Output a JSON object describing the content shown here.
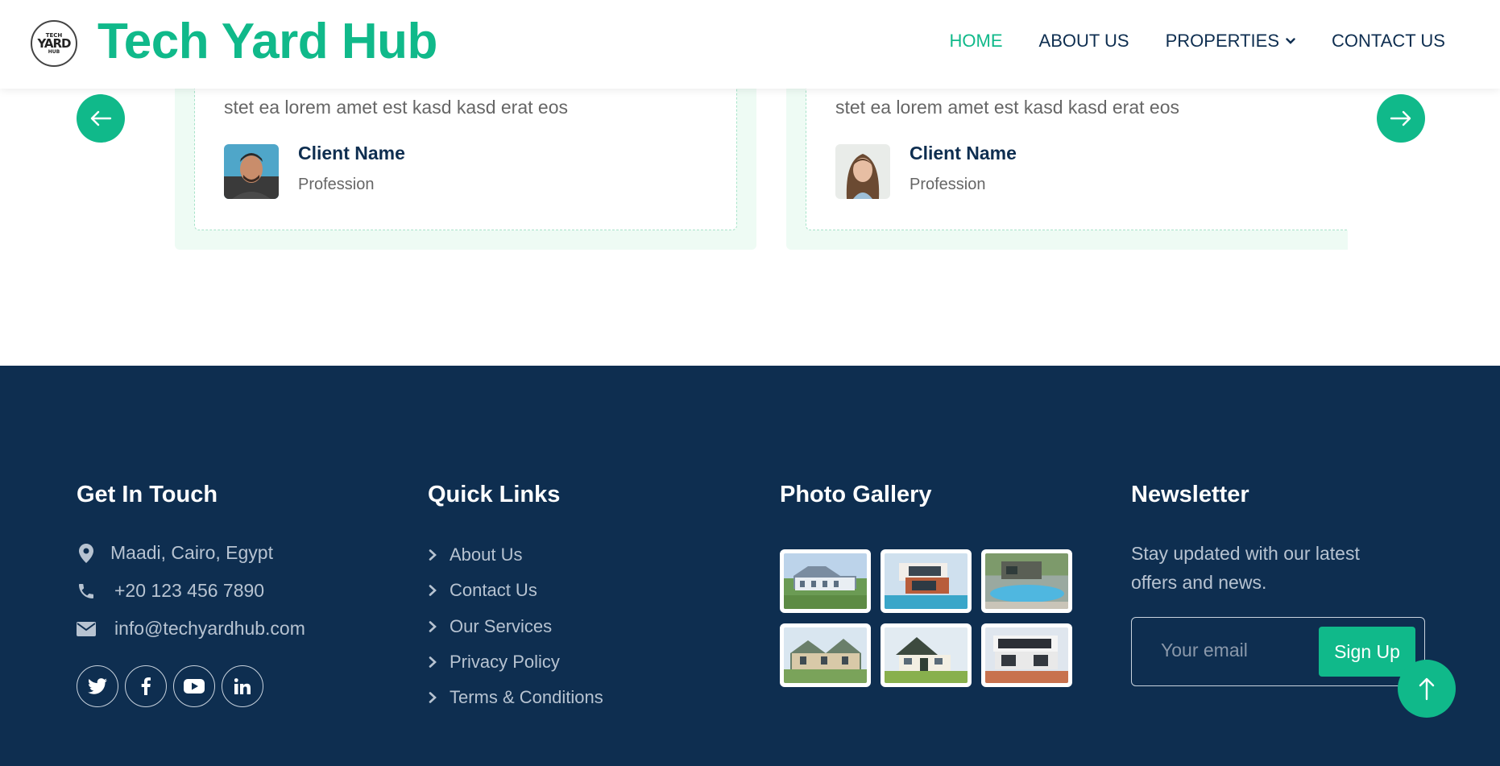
{
  "header": {
    "logo_text": [
      "TECH",
      "YARD",
      "HUB"
    ],
    "brand": "Tech Yard Hub",
    "nav": [
      {
        "label": "HOME",
        "active": true
      },
      {
        "label": "ABOUT US",
        "active": false
      },
      {
        "label": "PROPERTIES",
        "active": false,
        "dropdown": true
      },
      {
        "label": "CONTACT US",
        "active": false
      }
    ]
  },
  "testimonials": {
    "prev_icon": "arrow-left-icon",
    "next_icon": "arrow-right-icon",
    "items": [
      {
        "text": "stet ea lorem amet est kasd kasd erat eos",
        "name": "Client Name",
        "profession": "Profession"
      },
      {
        "text": "stet ea lorem amet est kasd kasd erat eos",
        "name": "Client Name",
        "profession": "Profession"
      }
    ]
  },
  "footer": {
    "contact": {
      "title": "Get In Touch",
      "address": "Maadi, Cairo, Egypt",
      "phone": "+20 123 456 7890",
      "email": "info@techyardhub.com",
      "socials": [
        "twitter-icon",
        "facebook-icon",
        "youtube-icon",
        "linkedin-icon"
      ]
    },
    "quick_links": {
      "title": "Quick Links",
      "items": [
        "About Us",
        "Contact Us",
        "Our Services",
        "Privacy Policy",
        "Terms & Conditions"
      ]
    },
    "gallery": {
      "title": "Photo Gallery",
      "count": 6
    },
    "newsletter": {
      "title": "Newsletter",
      "text": "Stay updated with our latest offers and news.",
      "placeholder": "Your email",
      "button": "Sign Up"
    }
  },
  "colors": {
    "accent": "#10b98a",
    "navy": "#0e2e50",
    "muted": "#b7c3d1"
  }
}
